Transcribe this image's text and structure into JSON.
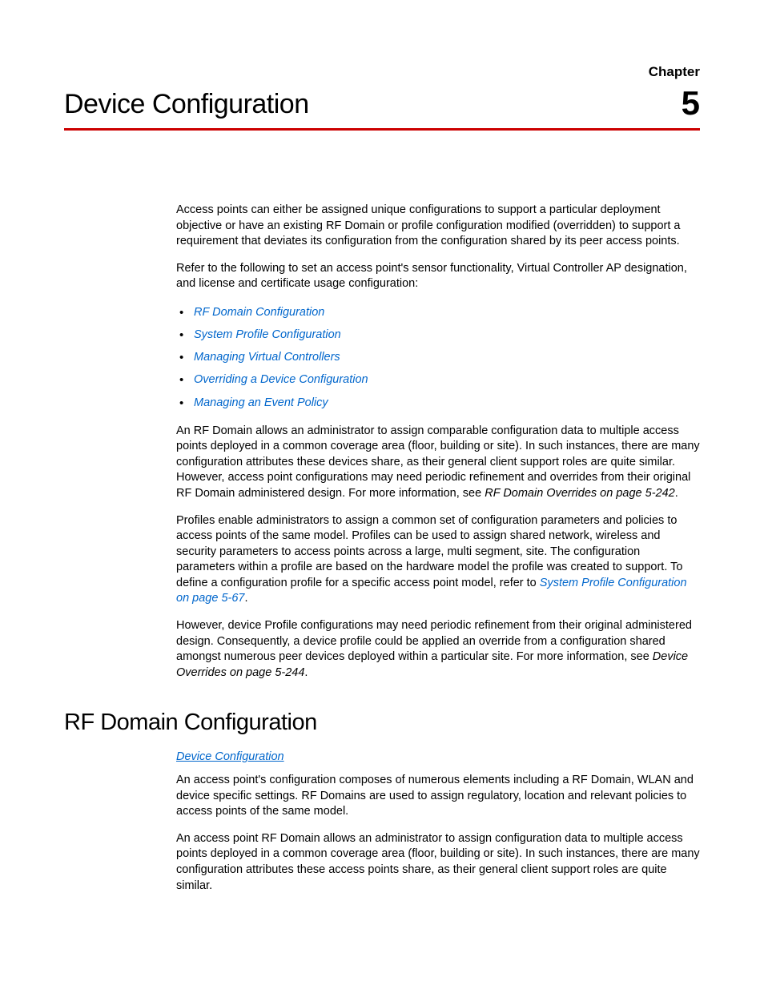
{
  "header": {
    "chapter_label": "Chapter",
    "chapter_number": "5",
    "chapter_title": "Device Configuration"
  },
  "body": {
    "para1": "Access points can either be assigned unique configurations to support a particular deployment objective or have an existing RF Domain or profile configuration modified (overridden) to support a requirement that deviates its configuration from the configuration shared by its peer access points.",
    "para2": "Refer to the following to set an access point's sensor functionality, Virtual Controller AP designation, and license and certificate usage configuration:",
    "bullets": [
      "RF Domain Configuration",
      "System Profile Configuration",
      "Managing Virtual Controllers",
      "Overriding a Device Configuration",
      "Managing an Event Policy"
    ],
    "para3_a": "An RF Domain allows an administrator to assign comparable configuration data to multiple access points deployed in a common coverage area (floor, building or site). In such instances, there are many configuration attributes these devices share, as their general client support roles are quite similar. However, access point configurations may need periodic refinement and overrides from their original RF Domain administered design. For more information, see ",
    "para3_ref": "RF Domain Overrides on page 5-242",
    "para3_b": ".",
    "para4_a": "Profiles enable administrators to assign a common set of configuration parameters and policies to access points of the same model. Profiles can be used to assign shared network, wireless and security parameters to access points across a large, multi segment, site. The configuration parameters within a profile are based on the hardware model the profile was created to support. To define a configuration profile for a specific access point model, refer to ",
    "para4_link": "System Profile Configuration on page 5-67",
    "para4_b": ".",
    "para5_a": "However, device Profile configurations may need periodic refinement from their original administered design. Consequently, a device profile could be applied an override from a configuration shared amongst numerous peer devices deployed within a particular site. For more information, see ",
    "para5_ref": "Device Overrides on page 5-244",
    "para5_b": "."
  },
  "section2": {
    "heading": "RF Domain Configuration",
    "breadcrumb": "Device Configuration",
    "para1": "An access point's configuration composes of numerous elements including a RF Domain, WLAN and device specific settings. RF Domains are used to assign regulatory, location and relevant policies to access points of the same model.",
    "para2": "An access point RF Domain allows an administrator to assign configuration data to multiple access points deployed in a common coverage area (floor, building or site). In such instances, there are many configuration attributes these access points share, as their general client support roles are quite similar."
  }
}
